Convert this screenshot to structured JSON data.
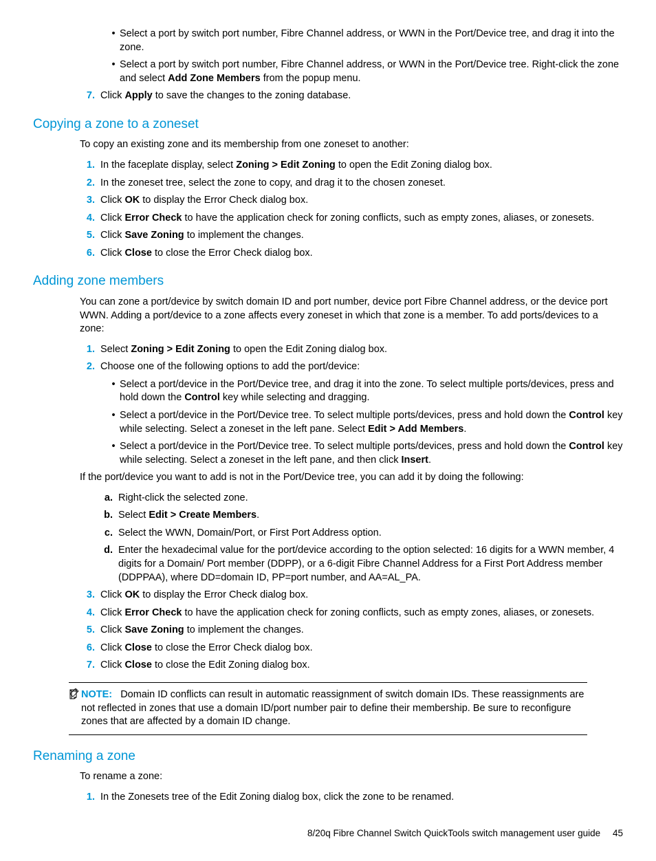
{
  "top_bullets": [
    "Select a port by switch port number, Fibre Channel address, or WWN in the Port/Device tree, and drag it into the zone.",
    "Select a port by switch port number, Fibre Channel address, or WWN in the Port/Device tree. Right-click the zone and select <b>Add Zone Members</b> from the popup menu."
  ],
  "top_step7": {
    "n": "7.",
    "t": "Click <b>Apply</b> to save the changes to the zoning database."
  },
  "sec1": {
    "title": "Copying a zone to a zoneset",
    "intro": "To copy an existing zone and its membership from one zoneset to another:",
    "steps": [
      {
        "n": "1.",
        "t": "In the faceplate display, select <b>Zoning > Edit Zoning</b> to open the Edit Zoning dialog box."
      },
      {
        "n": "2.",
        "t": "In the zoneset tree, select the zone to copy, and drag it to the chosen zoneset."
      },
      {
        "n": "3.",
        "t": "Click <b>OK</b> to display the Error Check dialog box."
      },
      {
        "n": "4.",
        "t": "Click <b>Error Check</b> to have the application check for zoning conflicts, such as empty zones, aliases, or zonesets."
      },
      {
        "n": "5.",
        "t": "Click <b>Save Zoning</b> to implement the changes."
      },
      {
        "n": "6.",
        "t": "Click <b>Close</b> to close the Error Check dialog box."
      }
    ]
  },
  "sec2": {
    "title": "Adding zone members",
    "intro": "You can zone a port/device by switch domain ID and port number, device port Fibre Channel address, or the device port WWN. Adding a port/device to a zone affects every zoneset in which that zone is a member. To add ports/devices to a zone:",
    "step1": {
      "n": "1.",
      "t": "Select <b>Zoning > Edit Zoning</b> to open the Edit Zoning dialog box."
    },
    "step2": {
      "n": "2.",
      "t": "Choose one of the following options to add the port/device:"
    },
    "step2_bullets": [
      "Select a port/device in the Port/Device tree, and drag it into the zone. To select multiple ports/devices, press and hold down the <b>Control</b> key while selecting and dragging.",
      "Select a port/device in the Port/Device tree. To select multiple ports/devices, press and hold down the <b>Control</b> key while selecting. Select a zoneset in the left pane. Select <b>Edit > Add Members</b>.",
      "Select a port/device in the Port/Device tree. To select multiple ports/devices, press and hold down the <b>Control</b> key while selecting. Select a zoneset in the left pane, and then click <b>Insert</b>."
    ],
    "mid_para": "If the port/device you want to add is not in the Port/Device tree, you can add it by doing the following:",
    "alpha": [
      {
        "n": "a.",
        "t": "Right-click the selected zone."
      },
      {
        "n": "b.",
        "t": "Select <b>Edit > Create Members</b>."
      },
      {
        "n": "c.",
        "t": "Select the WWN, Domain/Port, or First Port Address option."
      },
      {
        "n": "d.",
        "t": "Enter the hexadecimal value for the port/device according to the option selected: 16 digits for a WWN member, 4 digits for a Domain/ Port member (DDPP), or a 6-digit Fibre Channel Address for a First Port Address member (DDPPAA), where DD=domain ID, PP=port number, and AA=AL_PA."
      }
    ],
    "steps_cont": [
      {
        "n": "3.",
        "t": "Click <b>OK</b> to display the Error Check dialog box."
      },
      {
        "n": "4.",
        "t": "Click <b>Error Check</b> to have the application check for zoning conflicts, such as empty zones, aliases, or zonesets."
      },
      {
        "n": "5.",
        "t": "Click <b>Save Zoning</b> to implement the changes."
      },
      {
        "n": "6.",
        "t": "Click <b>Close</b> to close the Error Check dialog box."
      },
      {
        "n": "7.",
        "t": "Click <b>Close</b> to close the Edit Zoning dialog box."
      }
    ]
  },
  "note": {
    "label": "NOTE:",
    "text": "Domain ID conflicts can result in automatic reassignment of switch domain IDs. These reassignments are not reflected in zones that use a domain ID/port number pair to define their membership. Be sure to reconfigure zones that are affected by a domain ID change."
  },
  "sec3": {
    "title": "Renaming a zone",
    "intro": "To rename a zone:",
    "step1": {
      "n": "1.",
      "t": "In the Zonesets tree of the Edit Zoning dialog box, click the zone to be renamed."
    }
  },
  "footer": {
    "doc": "8/20q Fibre Channel Switch QuickTools switch management user guide",
    "page": "45"
  }
}
